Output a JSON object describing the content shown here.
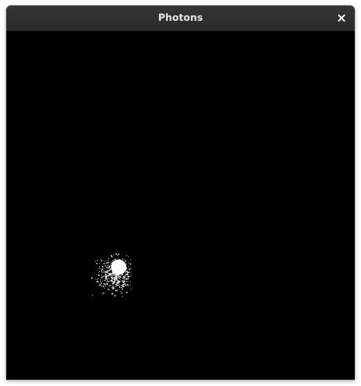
{
  "window": {
    "title": "Photons",
    "close_icon": "close-icon"
  },
  "canvas": {
    "background_color": "#000000",
    "photon_color": "#ffffff"
  }
}
